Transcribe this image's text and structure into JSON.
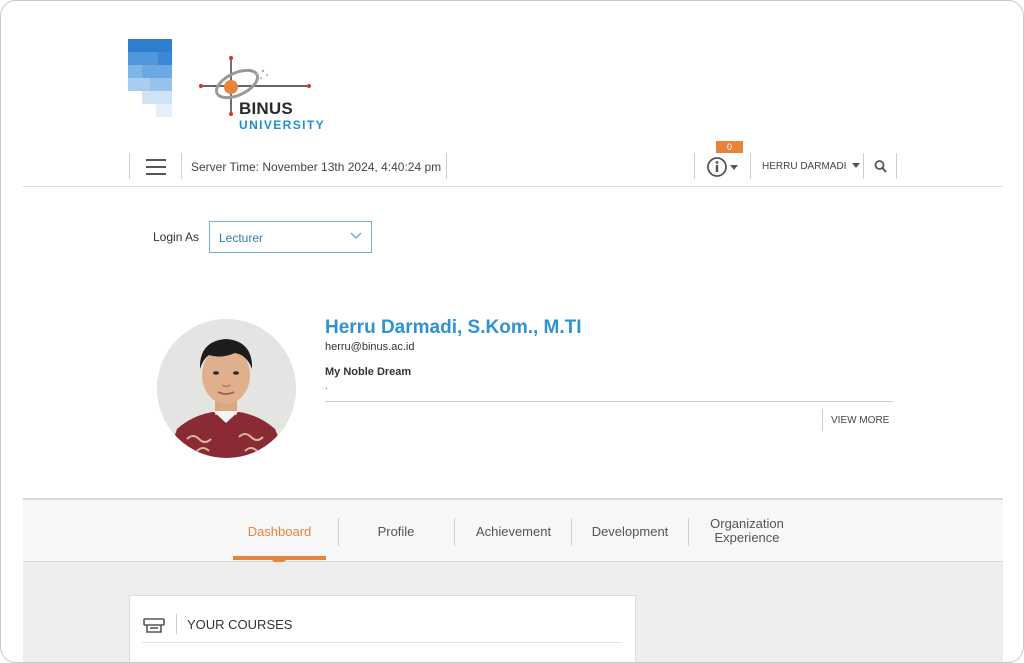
{
  "brand": {
    "name": "BINUS",
    "subtitle": "UNIVERSITY",
    "accent": "#1f8fd1"
  },
  "topbar": {
    "menu_icon": "hamburger-icon",
    "server_time": "Server Time: November 13th 2024, 4:40:24 pm",
    "notification_count": "0",
    "notification_icon": "info-icon",
    "user_name": "HERRU DARMADI",
    "search_icon": "search-icon"
  },
  "login": {
    "label": "Login As",
    "selected": "Lecturer"
  },
  "profile": {
    "name": "Herru Darmadi, S.Kom., M.TI",
    "email": "herru@binus.ac.id",
    "dream_label": "My Noble Dream",
    "dream_text": ".",
    "view_more": "VIEW MORE"
  },
  "tabs": [
    {
      "label": "Dashboard",
      "active": true
    },
    {
      "label": "Profile",
      "active": false
    },
    {
      "label": "Achievement",
      "active": false
    },
    {
      "label": "Development",
      "active": false
    },
    {
      "label": "Organization Experience",
      "active": false
    }
  ],
  "courses": {
    "title": "YOUR COURSES",
    "icon": "course-icon"
  },
  "colors": {
    "active_tab": "#e8843a",
    "name": "#2f93d2",
    "badge": "#e8843a"
  }
}
